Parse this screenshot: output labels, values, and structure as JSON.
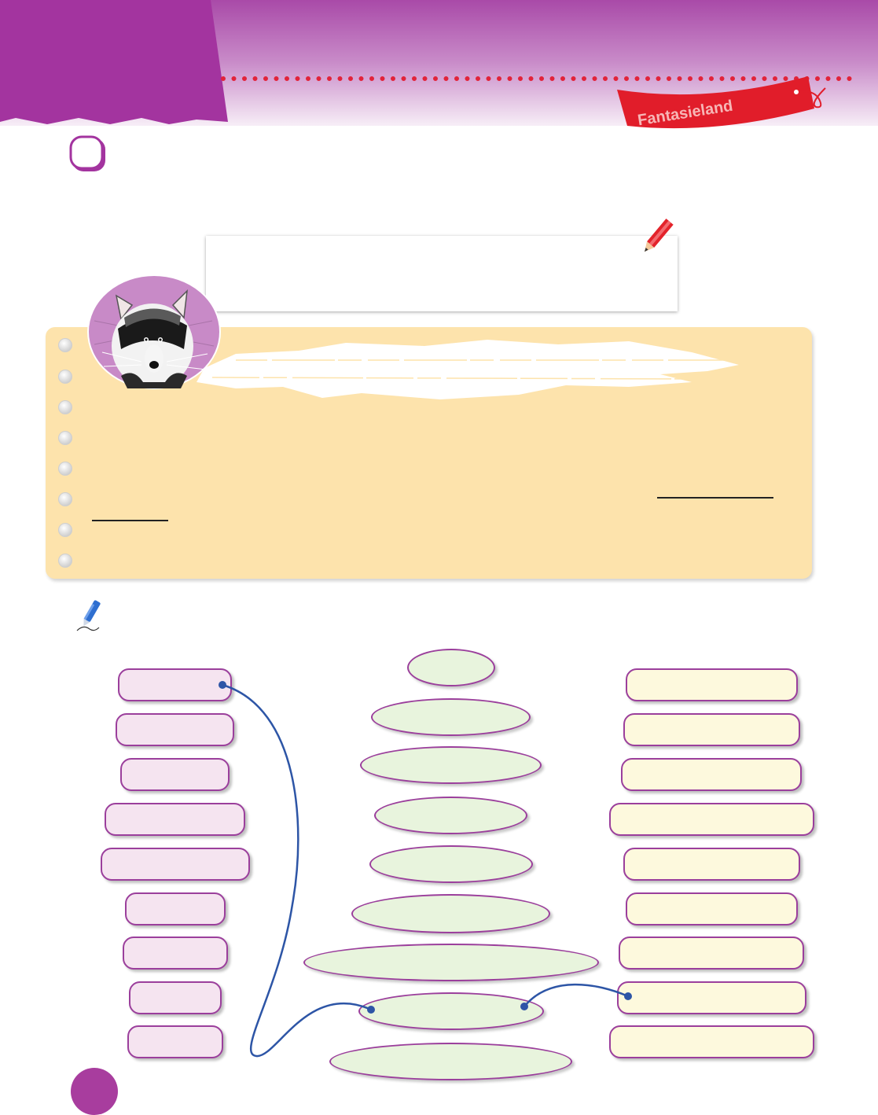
{
  "header": {
    "banner_text": "Fantasieland",
    "band_color": "#a94aa8",
    "banner_color": "#e11d2a"
  },
  "icons": {
    "pencil": "red-pencil-icon",
    "pen": "blue-pen-icon",
    "mascot": "raccoon-illustration"
  },
  "colors": {
    "line": "#2d55a6",
    "panel": "#fde3ac",
    "page_circle": "#a83d9e"
  }
}
